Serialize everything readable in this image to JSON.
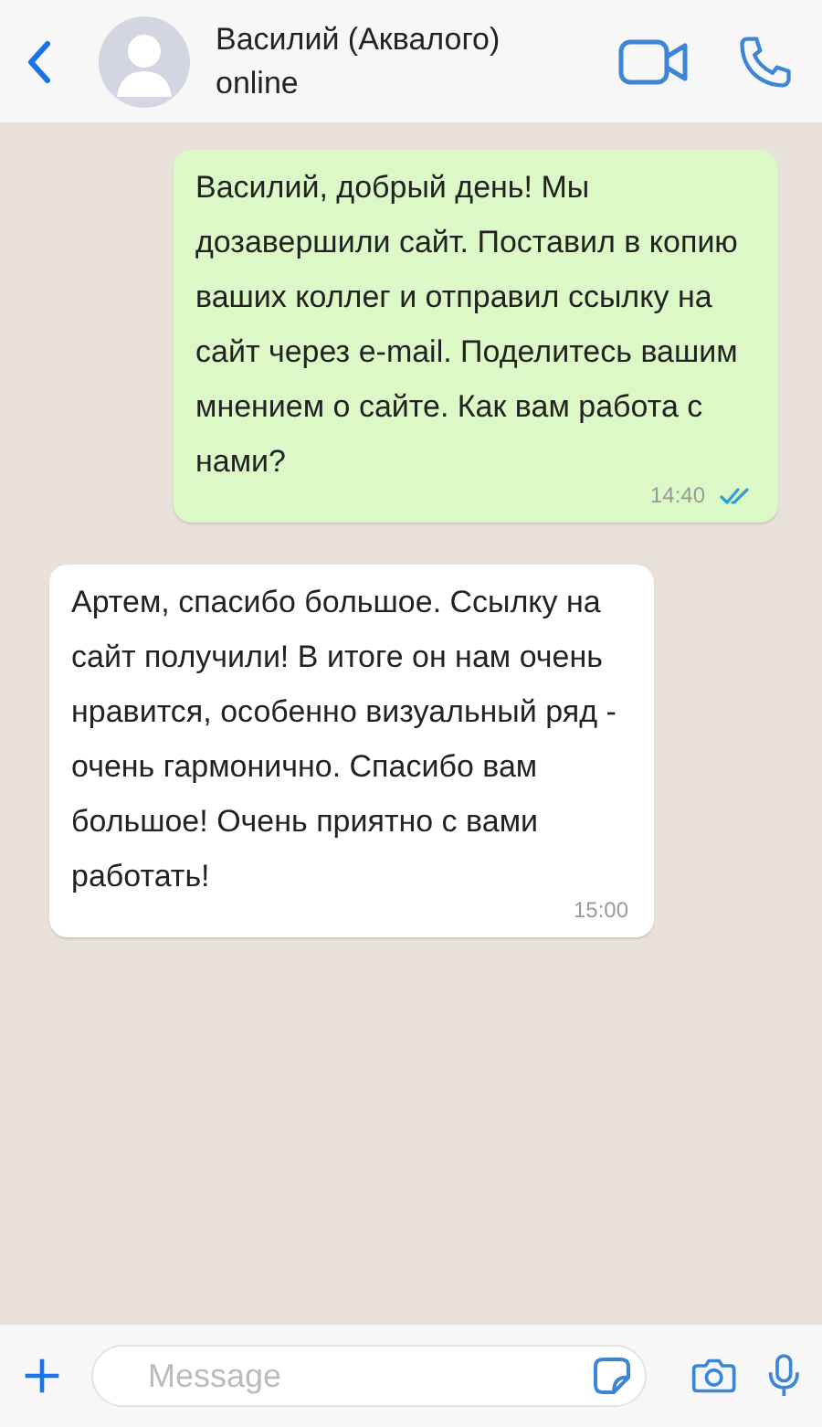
{
  "header": {
    "name": "Василий (Аквалого)",
    "status": "online"
  },
  "messages": [
    {
      "kind": "outgoing",
      "text": "Василий, добрый день! Мы дозавершили сайт. Поставил в копию ваших коллег и отправил ссылку на сайт через e-mail. Поделитесь вашим мнением о сайте. Как вам работа с нами?",
      "time": "14:40",
      "read": true
    },
    {
      "kind": "incoming",
      "text": "Артем, спасибо большое. Ссылку на сайт получили! В итоге он нам очень нравится, особенно визуальный ряд - очень гармонично. Спасибо вам большое! Очень приятно с вами работать!",
      "time": "15:00"
    }
  ],
  "composer": {
    "placeholder": "Message"
  }
}
